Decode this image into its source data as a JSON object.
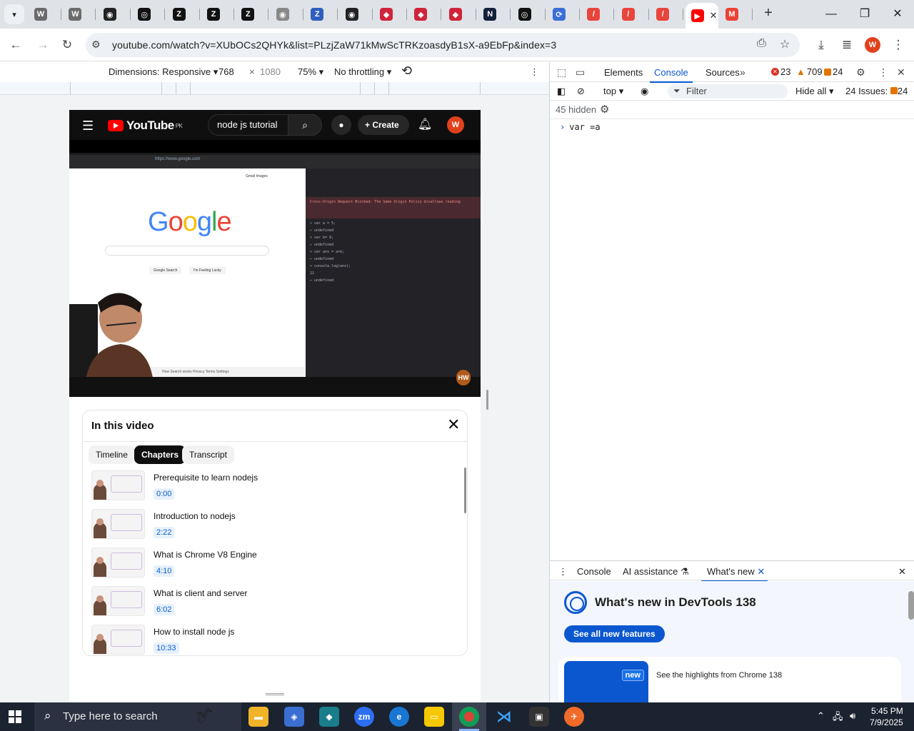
{
  "browser": {
    "tabs": [
      {
        "icon": "word-doc-icon",
        "glyph": "W",
        "color": "#6b6b6b"
      },
      {
        "icon": "word-doc-icon",
        "glyph": "W",
        "color": "#6b6b6b"
      },
      {
        "icon": "globe-tab-icon",
        "glyph": "◉",
        "color": "#222222"
      },
      {
        "icon": "openai-icon",
        "glyph": "◎",
        "color": "#111111"
      },
      {
        "icon": "z-icon",
        "glyph": "Z",
        "color": "#111111"
      },
      {
        "icon": "z-icon",
        "glyph": "Z",
        "color": "#111111"
      },
      {
        "icon": "z-icon",
        "glyph": "Z",
        "color": "#111111"
      },
      {
        "icon": "globe-tab-icon",
        "glyph": "◉",
        "color": "#888888"
      },
      {
        "icon": "z-icon",
        "glyph": "Z",
        "color": "#2f5ebd"
      },
      {
        "icon": "globe-tab-icon",
        "glyph": "◉",
        "color": "#222222"
      },
      {
        "icon": "diamond-red-icon",
        "glyph": "◆",
        "color": "#d0243a"
      },
      {
        "icon": "diamond-red-icon",
        "glyph": "◆",
        "color": "#d0243a"
      },
      {
        "icon": "diamond-red-icon",
        "glyph": "◆",
        "color": "#d0243a"
      },
      {
        "icon": "n-icon",
        "glyph": "N",
        "color": "#14213d"
      },
      {
        "icon": "openai-icon",
        "glyph": "◎",
        "color": "#111111"
      },
      {
        "icon": "swirl-icon",
        "glyph": "⟳",
        "color": "#3b6fd8"
      },
      {
        "icon": "slash-red-icon",
        "glyph": "/",
        "color": "#e8453c"
      },
      {
        "icon": "slash-red-icon",
        "glyph": "/",
        "color": "#e8453c"
      },
      {
        "icon": "slash-red-icon",
        "glyph": "/",
        "color": "#e8453c"
      },
      {
        "icon": "youtube-tab-icon",
        "glyph": "▶",
        "color": "#ff0000",
        "active": true
      },
      {
        "icon": "gmail-icon",
        "glyph": "M",
        "color": "#ea4335"
      }
    ],
    "url": "youtube.com/watch?v=XUbOCs2QHYk&list=PLzjZaW71kMwScTRKzoasdyB1sX-a9EbFp&index=3",
    "profile_initial": "W"
  },
  "device_toolbar": {
    "dimensions_label": "Dimensions: Responsive",
    "width": "768",
    "height": "1080",
    "zoom": "75%",
    "throttling": "No throttling"
  },
  "youtube": {
    "logo_text": "YouTube",
    "country": "PK",
    "search_value": "node js tutorial",
    "create_label": "Create",
    "avatar_initial": "W",
    "video": {
      "address": "https://www.google.com",
      "google_links": "Gmail  Images",
      "search_btn_1": "Google Search",
      "search_btn_2": "I'm Feeling Lucky",
      "footer": "How Search works   Privacy   Terms   Settings",
      "dt_lines": [
        "» var a = 5;",
        "← undefined",
        "» var b= 6;",
        "← undefined",
        "» var ans = a+b;",
        "← undefined",
        "» console.log(ans);",
        "   11",
        "← undefined"
      ],
      "dt_error": "Cross-Origin Request Blocked: The Same Origin Policy disallows reading",
      "watermark": "HW"
    },
    "chapters_panel": {
      "title": "In this video",
      "tabs": [
        "Timeline",
        "Chapters",
        "Transcript"
      ],
      "selected_tab": "Chapters",
      "items": [
        {
          "title": "Prerequisite to learn nodejs",
          "time": "0:00"
        },
        {
          "title": "Introduction to nodejs",
          "time": "2:22"
        },
        {
          "title": "What is Chrome V8 Engine",
          "time": "4:10"
        },
        {
          "title": "What is client and server",
          "time": "6:02"
        },
        {
          "title": "How to install node js",
          "time": "10:33"
        }
      ]
    }
  },
  "devtools": {
    "tabs": [
      "Elements",
      "Console",
      "Sources"
    ],
    "active_tab": "Console",
    "errors": "23",
    "warnings": "709",
    "issues_count": "24",
    "context": "top",
    "filter_placeholder": "Filter",
    "levels": "Hide all",
    "issues_label": "24 Issues:",
    "issues_badge": "24",
    "hidden_label": "45 hidden",
    "console_input": "var =a",
    "drawer": {
      "tabs": [
        "Console",
        "AI assistance",
        "What's new"
      ],
      "active_tab": "What's new",
      "title": "What's new in DevTools 138",
      "button": "See all new features",
      "card_badge": "new",
      "card_text": "See the highlights from Chrome 138"
    }
  },
  "taskbar": {
    "search_placeholder": "Type here to search",
    "time": "5:45 PM",
    "date": "7/9/2025"
  }
}
